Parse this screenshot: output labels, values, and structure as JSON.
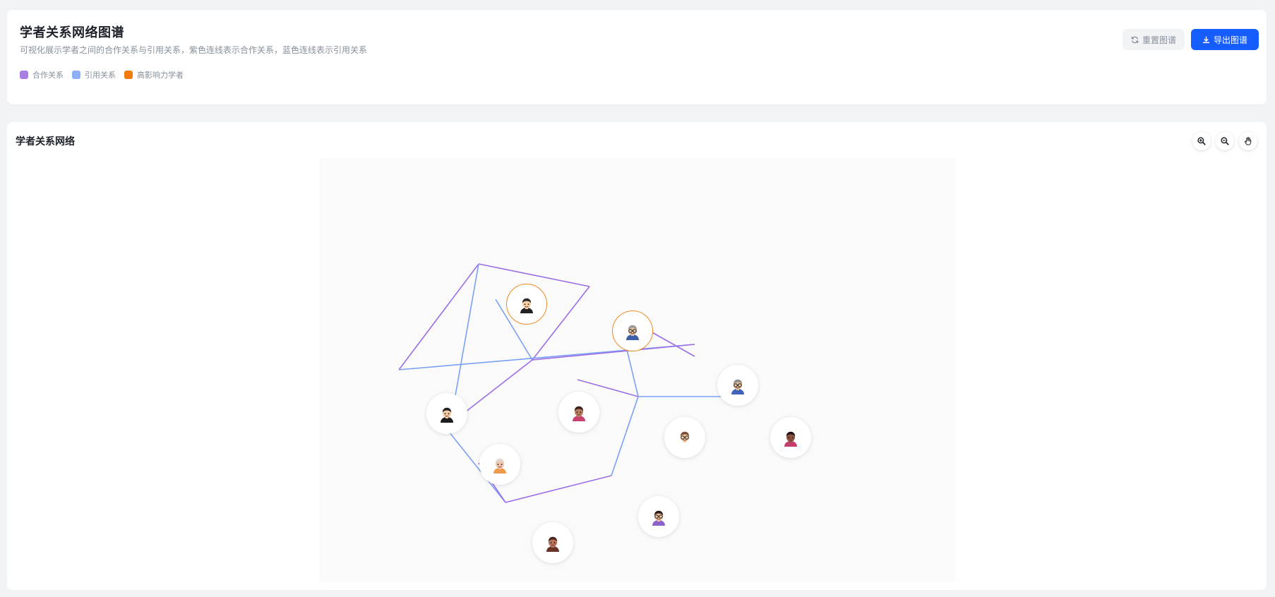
{
  "header": {
    "title": "学者关系网络图谱",
    "description": "可视化展示学者之间的合作关系与引用关系，紫色连线表示合作关系，蓝色连线表示引用关系",
    "legend": [
      {
        "label": "合作关系",
        "color": "#a87fe3"
      },
      {
        "label": "引用关系",
        "color": "#8fb0f5"
      },
      {
        "label": "高影响力学者",
        "color": "#f07c0e"
      }
    ],
    "reset_label": "重置图谱",
    "export_label": "导出图谱"
  },
  "graph": {
    "title": "学者关系网络",
    "toolbar": [
      "zoom-in-icon",
      "zoom-out-icon",
      "pan-hand-icon"
    ],
    "colors": {
      "collaboration": "#9b6ee6",
      "citation": "#7aa0f5",
      "high_impact": "#f08a24"
    },
    "nodes": [
      {
        "id": "n1",
        "high_impact": true,
        "skin": "#f5cfa8",
        "hair": "#2b2b2b",
        "shirt": "#222222",
        "glasses": false
      },
      {
        "id": "n2",
        "high_impact": true,
        "skin": "#e9c4a1",
        "hair": "#9a9a9a",
        "shirt": "#3f5ea8",
        "glasses": true
      },
      {
        "id": "n3",
        "high_impact": false,
        "skin": "#f3c9a3",
        "hair": "#222222",
        "shirt": "#1d1d1d",
        "glasses": false
      },
      {
        "id": "n4",
        "high_impact": false,
        "skin": "#b77d5f",
        "hair": "#3a2320",
        "shirt": "#c8416f",
        "glasses": false
      },
      {
        "id": "n5",
        "high_impact": false,
        "skin": "#ebc09d",
        "hair": "#8e8e8e",
        "shirt": "#3f63b8",
        "glasses": true
      },
      {
        "id": "n6",
        "high_impact": false,
        "skin": "#f1c8a4",
        "hair": "#7a4f33",
        "shirt": "#ffffff",
        "glasses": true
      },
      {
        "id": "n7",
        "high_impact": false,
        "skin": "#8a5440",
        "hair": "#241514",
        "shirt": "#c73d6b",
        "glasses": false
      },
      {
        "id": "n8",
        "high_impact": false,
        "skin": "#f2c6ad",
        "hair": "#e3d6cf",
        "shirt": "#ef9a4a",
        "glasses": false
      },
      {
        "id": "n9",
        "high_impact": false,
        "skin": "#f0c29c",
        "hair": "#2a1b17",
        "shirt": "#8b63c9",
        "glasses": true
      },
      {
        "id": "n10",
        "high_impact": false,
        "skin": "#b9735b",
        "hair": "#4a2620",
        "shirt": "#6a3327",
        "glasses": false
      }
    ],
    "edges": [
      {
        "from": "n1",
        "to": "n3",
        "type": "collaboration"
      },
      {
        "from": "n1",
        "to": "n2",
        "type": "collaboration"
      },
      {
        "from": "n1",
        "to": "n8",
        "type": "citation"
      },
      {
        "from": "n1",
        "to": "n4",
        "type": "citation"
      },
      {
        "from": "n2",
        "to": "n4",
        "type": "collaboration"
      },
      {
        "from": "n2",
        "to": "n5",
        "type": "collaboration"
      },
      {
        "from": "n2",
        "to": "n6",
        "type": "citation"
      },
      {
        "from": "n3",
        "to": "n5",
        "type": "citation"
      },
      {
        "from": "n3",
        "to": "n10",
        "type": "citation"
      },
      {
        "from": "n4",
        "to": "n8",
        "type": "collaboration"
      },
      {
        "from": "n4",
        "to": "n5",
        "type": "collaboration"
      },
      {
        "from": "n4",
        "to": "n6",
        "type": "collaboration"
      },
      {
        "from": "n5",
        "to": "n7",
        "type": "citation"
      },
      {
        "from": "n6",
        "to": "n7",
        "type": "citation"
      },
      {
        "from": "n6",
        "to": "n9",
        "type": "citation"
      },
      {
        "from": "n8",
        "to": "n10",
        "type": "collaboration"
      },
      {
        "from": "n9",
        "to": "n10",
        "type": "collaboration"
      }
    ]
  }
}
